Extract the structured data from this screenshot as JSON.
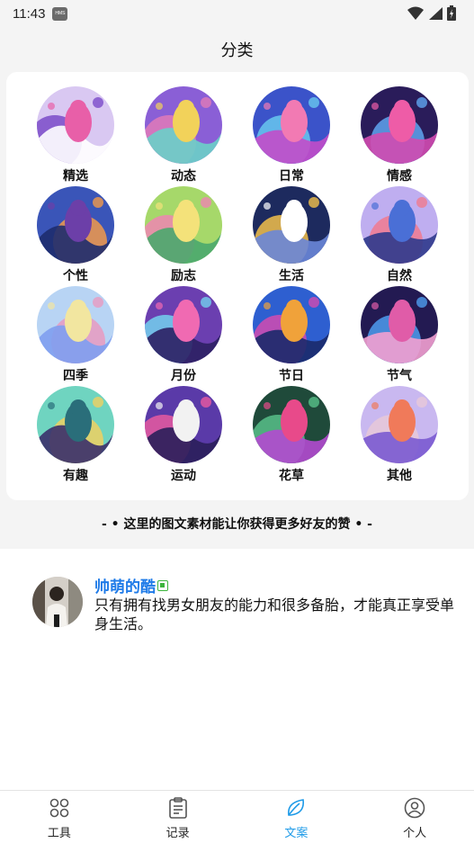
{
  "status_bar": {
    "time": "11:43",
    "badge": "HMS"
  },
  "page": {
    "title": "分类"
  },
  "categories": [
    {
      "label": "精选",
      "icon": "bunnies-art",
      "colors": [
        "#d9c8f2",
        "#e85fa8",
        "#7a4bc9",
        "#ffffff"
      ]
    },
    {
      "label": "动态",
      "icon": "cat-art",
      "colors": [
        "#8a5fd6",
        "#f2d25a",
        "#e07ab8",
        "#6ad0c8"
      ]
    },
    {
      "label": "日常",
      "icon": "girl-fish-art",
      "colors": [
        "#3b53c9",
        "#f27ab3",
        "#69c8ef",
        "#c34dc9"
      ]
    },
    {
      "label": "情感",
      "icon": "swimmer-art",
      "colors": [
        "#2a1c5a",
        "#ee5ca7",
        "#5fa5f0",
        "#d24bb0"
      ]
    },
    {
      "label": "个性",
      "icon": "whale-art",
      "colors": [
        "#3a55b8",
        "#6c3fa8",
        "#f29a4a",
        "#1e2c6e"
      ]
    },
    {
      "label": "励志",
      "icon": "forest-girl-art",
      "colors": [
        "#a6d86a",
        "#f4e27a",
        "#ee86b1",
        "#4aa86e"
      ]
    },
    {
      "label": "生活",
      "icon": "tiger-art",
      "colors": [
        "#1d2a5e",
        "#ffffff",
        "#f2c04a",
        "#6a86d8"
      ]
    },
    {
      "label": "自然",
      "icon": "dolphin-art",
      "colors": [
        "#bfaef0",
        "#4a6fd6",
        "#f07a8f",
        "#2f3a8c"
      ]
    },
    {
      "label": "四季",
      "icon": "moon-art",
      "colors": [
        "#b8d4f4",
        "#f2e6a0",
        "#e89ac0",
        "#7f9ff0"
      ]
    },
    {
      "label": "月份",
      "icon": "camera-art",
      "colors": [
        "#6b3fb0",
        "#f06ab2",
        "#73d1ee",
        "#2c2063"
      ]
    },
    {
      "label": "节日",
      "icon": "whale-forest-art",
      "colors": [
        "#2e5fd0",
        "#f0a23a",
        "#d24bb0",
        "#1b2a6a"
      ]
    },
    {
      "label": "节气",
      "icon": "mermaid-art",
      "colors": [
        "#231a52",
        "#e05ca8",
        "#4d9ef0",
        "#f2a0d0"
      ]
    },
    {
      "label": "有趣",
      "icon": "island-art",
      "colors": [
        "#6fd4c0",
        "#2a6e7a",
        "#f0d060",
        "#3a2f6a"
      ]
    },
    {
      "label": "运动",
      "icon": "chef-art",
      "colors": [
        "#5a3aa8",
        "#f2f2f2",
        "#e85aa0",
        "#2a1f5a"
      ]
    },
    {
      "label": "花草",
      "icon": "crane-art",
      "colors": [
        "#1f4a3a",
        "#e84a8a",
        "#58c08a",
        "#b24ad0"
      ]
    },
    {
      "label": "其他",
      "icon": "fox-art",
      "colors": [
        "#c9b8f0",
        "#f07a5a",
        "#e8c8d8",
        "#7a5ad0"
      ]
    }
  ],
  "tagline": "- •  这里的图文素材能让你获得更多好友的赞  • -",
  "post": {
    "author": "帅萌的酷",
    "text": "只有拥有找男女朋友的能力和很多备胎，才能真正享受单身生活。"
  },
  "tabs": [
    {
      "label": "工具",
      "icon": "tools-grid-icon",
      "active": false
    },
    {
      "label": "记录",
      "icon": "clipboard-icon",
      "active": false
    },
    {
      "label": "文案",
      "icon": "leaf-icon",
      "active": true
    },
    {
      "label": "个人",
      "icon": "person-icon",
      "active": false
    }
  ],
  "colors": {
    "accent": "#1f9be8",
    "author": "#1f7be8",
    "background": "#f4f4f4",
    "card": "#ffffff"
  }
}
